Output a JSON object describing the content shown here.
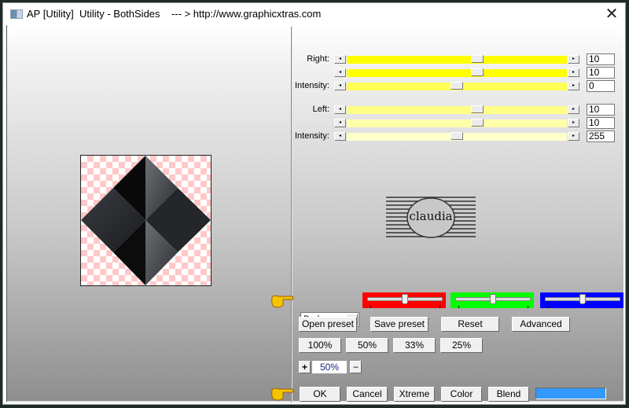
{
  "window": {
    "title": "AP [Utility]  Utility - BothSides    --- > http://www.graphicxtras.com",
    "close_glyph": "✕"
  },
  "sliders": {
    "right": {
      "label": "Right:",
      "color": "#ffff00",
      "rows": [
        {
          "label": "Right:",
          "value": "10",
          "position": 0.6
        },
        {
          "label": "",
          "value": "10",
          "position": 0.6
        },
        {
          "label": "Intensity:",
          "value": "0",
          "position": 0.5,
          "color": "#ffff55"
        }
      ]
    },
    "left": {
      "label": "Left:",
      "color": "#ffff88",
      "rows": [
        {
          "label": "Left:",
          "value": "10",
          "position": 0.6
        },
        {
          "label": "",
          "value": "10",
          "position": 0.6,
          "color": "#ffffaa"
        },
        {
          "label": "Intensity:",
          "value": "255",
          "position": 0.5,
          "color": "#ffffcc"
        }
      ]
    }
  },
  "logo": {
    "text": "claudia"
  },
  "blend_mode": {
    "selected": "Darker"
  },
  "channel_sliders": [
    {
      "name": "red",
      "color": "#ff0000",
      "position": 0.5
    },
    {
      "name": "green",
      "color": "#00ff00",
      "position": 0.5
    },
    {
      "name": "blue",
      "color": "#0000ff",
      "position": 0.5
    }
  ],
  "buttons": {
    "open_preset": "Open preset",
    "save_preset": "Save preset",
    "reset": "Reset",
    "advanced": "Advanced",
    "zoom_100": "100%",
    "zoom_50": "50%",
    "zoom_33": "33%",
    "zoom_25": "25%",
    "zoom_in": "+",
    "zoom_out": "−",
    "ok": "OK",
    "cancel": "Cancel",
    "xtreme": "Xtreme",
    "color": "Color",
    "blend": "Blend"
  },
  "zoom_level": "50%",
  "color_swatch": "#3399ff"
}
